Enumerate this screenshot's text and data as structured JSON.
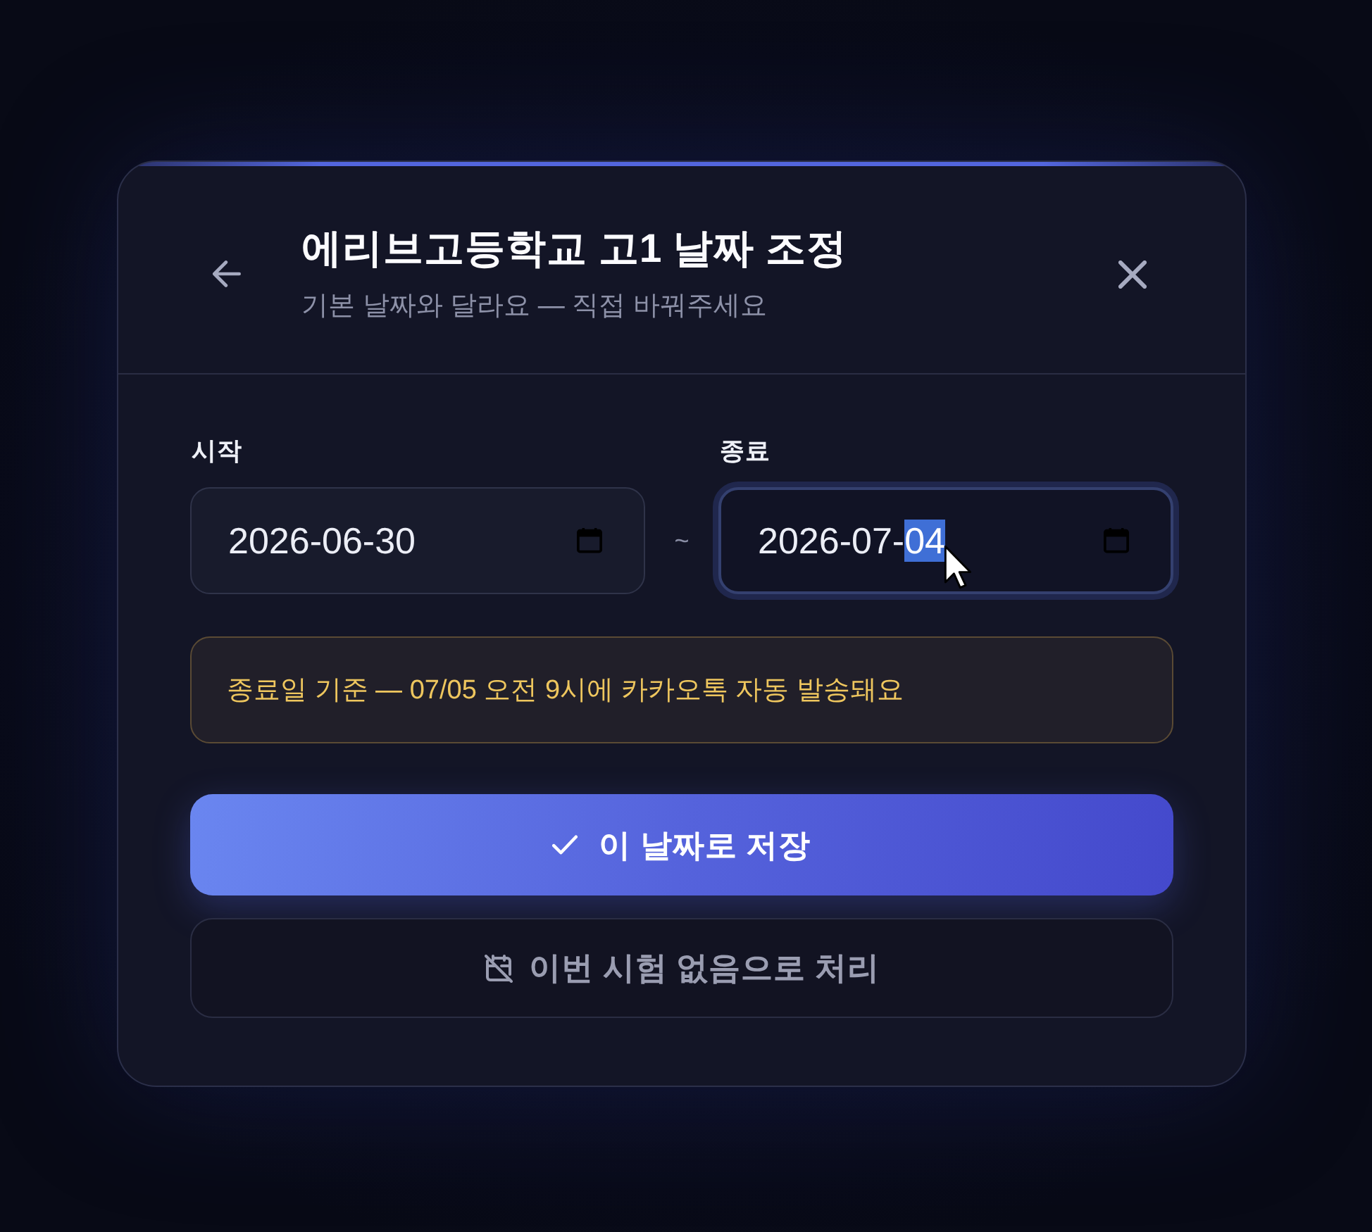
{
  "dialog": {
    "title": "에리브고등학교 고1 날짜 조정",
    "subtitle": "기본 날짜와 달라요 — 직접 바꿔주세요"
  },
  "range": {
    "separator": "~",
    "fields": [
      {
        "label": "시작",
        "focused": false,
        "segments": [
          {
            "text": "2026-06-30",
            "selected": false
          }
        ]
      },
      {
        "label": "종료",
        "focused": true,
        "segments": [
          {
            "text": "2026-07-",
            "selected": false
          },
          {
            "text": "04",
            "selected": true
          }
        ]
      }
    ]
  },
  "notice": {
    "text": "종료일 기준 — 07/05 오전 9시에 카카오톡 자동 발송돼요"
  },
  "actions": [
    {
      "kind": "primary",
      "label": "이 날짜로 저장"
    },
    {
      "kind": "secondary",
      "label": "이번 시험 없음으로 처리"
    }
  ]
}
